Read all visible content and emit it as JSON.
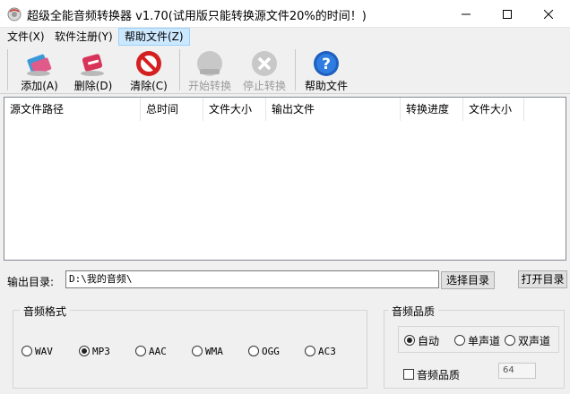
{
  "window": {
    "title": "超级全能音频转换器 v1.70(试用版只能转换源文件20%的时间！)"
  },
  "menu": [
    {
      "label": "文件(X)"
    },
    {
      "label": "软件注册(Y)"
    },
    {
      "label": "帮助文件(Z)"
    }
  ],
  "toolbar": {
    "add": "添加(A)",
    "delete": "删除(D)",
    "clear": "清除(C)",
    "start": "开始转换",
    "stop": "停止转换",
    "help": "帮助文件"
  },
  "list": {
    "columns": [
      "源文件路径",
      "总时间",
      "文件大小",
      "输出文件",
      "转换进度",
      "文件大小"
    ]
  },
  "output": {
    "label": "输出目录:",
    "value": "D:\\我的音频\\",
    "choose_btn": "选择目录",
    "open_btn": "打开目录"
  },
  "format": {
    "group_label": "音频格式",
    "options": [
      "WAV",
      "MP3",
      "AAC",
      "WMA",
      "OGG",
      "AC3"
    ],
    "selected": "MP3"
  },
  "quality": {
    "group_label": "音频品质",
    "channels": [
      "自动",
      "单声道",
      "双声道"
    ],
    "selected": "自动",
    "checkbox_label": "音频品质",
    "value": "64"
  },
  "colors": {
    "menu_active_bg": "#cce8ff",
    "help_icon": "#1e5fbf",
    "clear_icon": "#d42020",
    "delete_icon": "#d8345a"
  }
}
